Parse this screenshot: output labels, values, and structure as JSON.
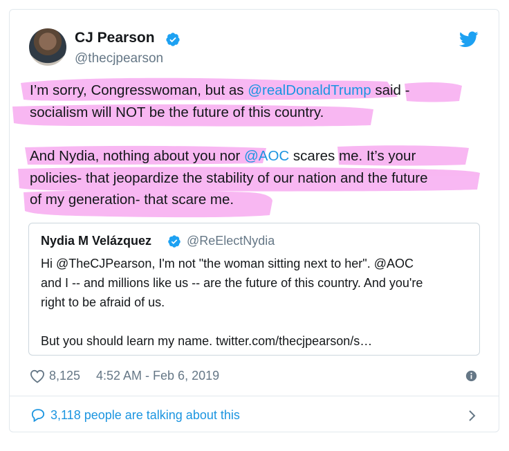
{
  "author": {
    "name": "CJ Pearson",
    "handle": "@thecjpearson"
  },
  "tweet": {
    "para1_line1_a": "I’m sorry, Congresswoman, but as ",
    "para1_mention": "@realDonaldTrump",
    "para1_line1_b": " said -",
    "para1_line2": "socialism will NOT be the future of this country.",
    "para2_line1_a": "And Nydia, nothing about you nor ",
    "para2_mention": "@AOC",
    "para2_line1_b": " scares me. It’s your",
    "para2_line2": "policies- that jeopardize the stability of our nation and the future",
    "para2_line3": "of my generation- that scare me."
  },
  "quoted": {
    "name": "Nydia M Velázquez",
    "handle": "@ReElectNydia",
    "line1": "Hi @TheCJPearson, I'm not \"the woman sitting next to her\". @AOC",
    "line2": "and I -- and millions like us -- are the future of this country. And you're",
    "line3": "right to be afraid of us.",
    "line4": "But you should learn my name. twitter.com/thecjpearson/s…"
  },
  "footer": {
    "like_count": "8,125",
    "timestamp": "4:52 AM - Feb 6, 2019",
    "talking": "3,118 people are talking about this"
  },
  "icons": {
    "verified": "verified-badge-icon",
    "bird": "twitter-bird-icon",
    "heart": "heart-icon",
    "info": "info-icon",
    "reply": "speech-bubble-icon",
    "chevron": "chevron-right-icon"
  },
  "colors": {
    "link": "#1b95e0",
    "highlight": "#f7a8f0",
    "muted": "#657786"
  }
}
